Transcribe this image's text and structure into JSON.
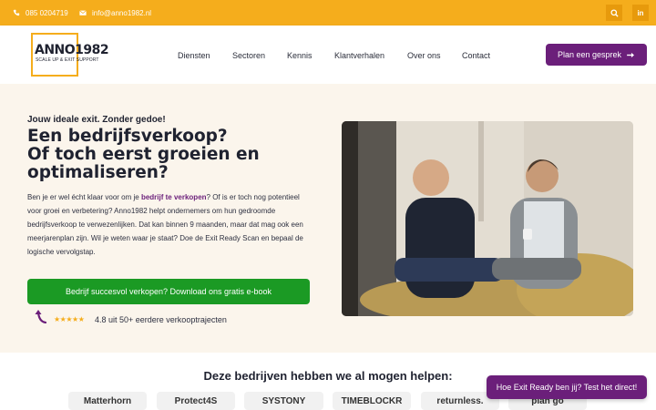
{
  "topbar": {
    "phone": "085 0204719",
    "email": "info@anno1982.nl",
    "search_icon": "search-icon",
    "linkedin_label": "in"
  },
  "header": {
    "logo_main": "ANNO1982",
    "logo_sub": "SCALE UP & EXIT SUPPORT",
    "nav": [
      "Diensten",
      "Sectoren",
      "Kennis",
      "Klantverhalen",
      "Over ons",
      "Contact"
    ],
    "cta": "Plan een gesprek"
  },
  "hero": {
    "kicker": "Jouw ideale exit. Zonder gedoe!",
    "headline": [
      "Een bedrijfsverkoop?",
      "Of toch eerst groeien en",
      "optimaliseren?"
    ],
    "body_pre": "Ben je er wel écht klaar voor om je ",
    "body_link": "bedrijf te verkopen",
    "body_post": "? Of is er toch nog potentieel voor groei en verbetering? Anno1982 helpt ondernemers om hun gedroomde bedrijfsverkoop te verwezenlijken. Dat kan binnen 9 maanden, maar dat mag ook een meerjarenplan zijn. Wil je weten waar je staat? Doe de Exit Ready Scan en bepaal de logische vervolgstap.",
    "cta": "Bedrijf succesvol verkopen? Download ons gratis e-book",
    "rating_value": 5,
    "rating_text": "4.8 uit 50+ eerdere verkooptrajecten"
  },
  "clients": {
    "title": "Deze bedrijven hebben we al mogen helpen:",
    "logos": [
      "Matterhorn",
      "Protect4S",
      "SYSTONY",
      "TIMEBLOCKR",
      "returnless.",
      "plan go"
    ]
  },
  "floating_cta": "Hoe Exit Ready ben jij? Test het direct!",
  "colors": {
    "brand_orange": "#f5ad1c",
    "brand_purple": "#6b1f7a",
    "cta_green": "#1b9a24",
    "hero_bg": "#fbf5ec"
  }
}
